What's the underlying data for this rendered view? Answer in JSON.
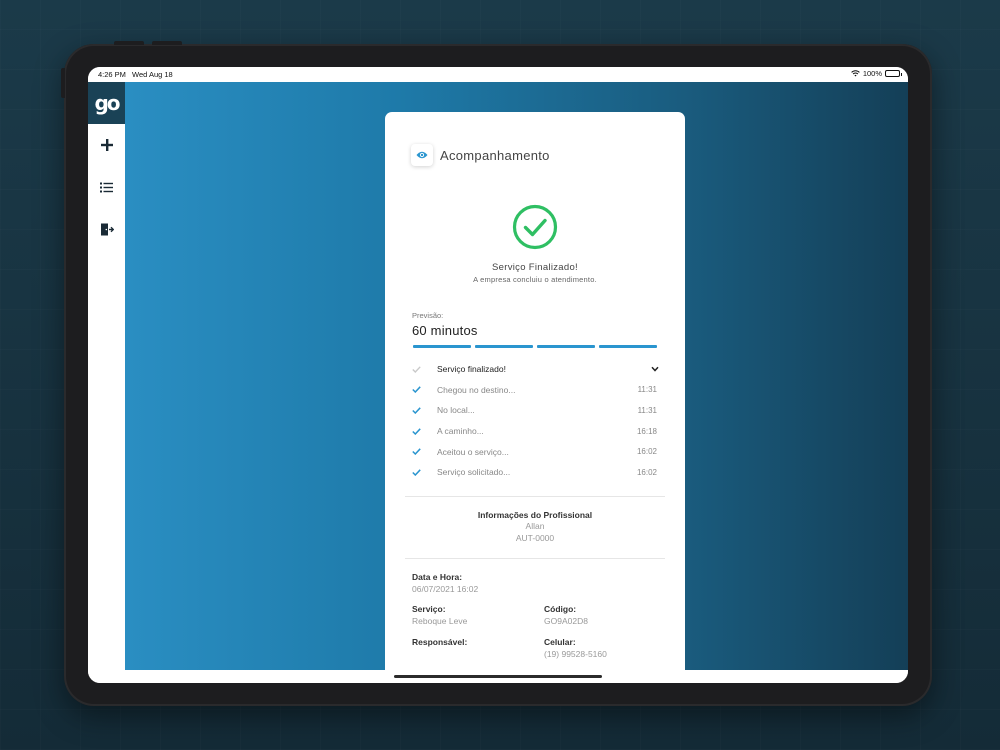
{
  "statusbar": {
    "time": "4:26 PM",
    "date": "Wed Aug 18",
    "battery": "100%"
  },
  "sidebar": {
    "logo_text": "go",
    "items": [
      {
        "icon": "plus-icon"
      },
      {
        "icon": "list-icon"
      },
      {
        "icon": "logout-icon"
      }
    ]
  },
  "card": {
    "title": "Acompanhamento",
    "status": {
      "title": "Serviço Finalizado!",
      "subtitle": "A empresa concluiu o atendimento."
    },
    "forecast": {
      "label": "Previsão:",
      "value": "60 minutos",
      "segments_complete": 4,
      "segments_total": 4
    },
    "timeline": [
      {
        "label": "Serviço finalizado!",
        "time": "",
        "done": false,
        "expandable": true
      },
      {
        "label": "Chegou no destino...",
        "time": "11:31",
        "done": true
      },
      {
        "label": "No local...",
        "time": "11:31",
        "done": true
      },
      {
        "label": "A caminho...",
        "time": "16:18",
        "done": true
      },
      {
        "label": "Aceitou o serviço...",
        "time": "16:02",
        "done": true
      },
      {
        "label": "Serviço solicitado...",
        "time": "16:02",
        "done": true
      }
    ],
    "professional": {
      "title": "Informações do Profissional",
      "name": "Allan",
      "id": "AUT-0000"
    },
    "details": {
      "datetime_label": "Data e Hora:",
      "datetime_value": "06/07/2021 16:02",
      "service_label": "Serviço:",
      "service_value": "Reboque Leve",
      "code_label": "Código:",
      "code_value": "GO9A02D8",
      "responsible_label": "Responsável:",
      "responsible_value": "",
      "phone_label": "Celular:",
      "phone_value": "(19) 99528-5160"
    }
  },
  "colors": {
    "accent": "#2a95cf",
    "success": "#2fbf63",
    "logo_bg": "#1a4256"
  }
}
